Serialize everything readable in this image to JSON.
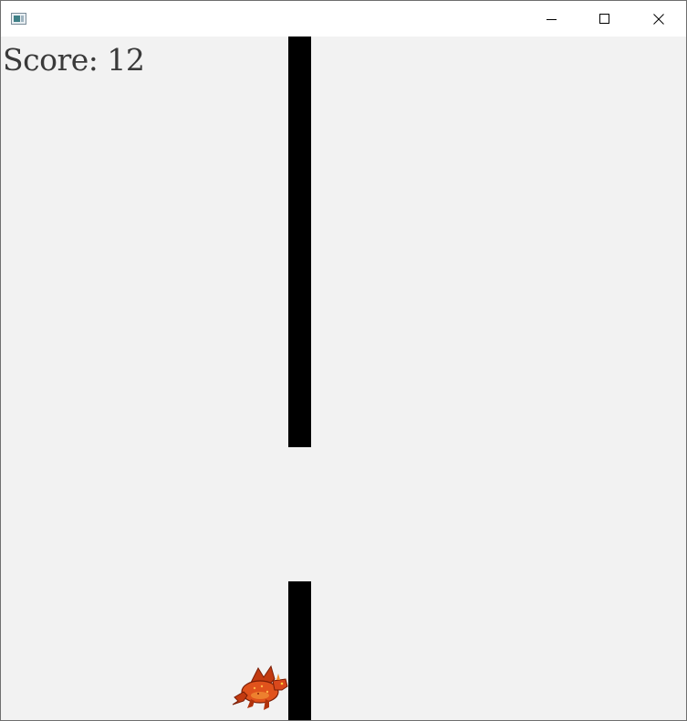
{
  "window": {
    "title": "",
    "icons": {
      "app": "app-window-icon",
      "minimize": "minimize-icon",
      "maximize": "maximize-icon",
      "close": "close-icon"
    }
  },
  "game": {
    "score_text": "Score: 12",
    "score": 12,
    "player": "dragon-sprite",
    "colors": {
      "background": "#f2f2f2",
      "pipe": "#000000",
      "score_text": "#3a3a3a",
      "dragon": "#d9481c"
    }
  }
}
